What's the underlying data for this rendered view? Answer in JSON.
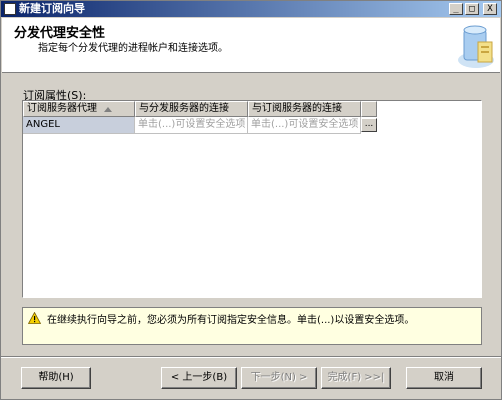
{
  "window": {
    "title": "新建订阅向导",
    "controls": {
      "minimize": "_",
      "maximize": "□",
      "close": "X"
    }
  },
  "header": {
    "heading": "分发代理安全性",
    "subheading": "指定每个分发代理的进程帐户和连接选项。",
    "icon": "wizard-icon"
  },
  "properties": {
    "label": "订阅属性(S):",
    "columns": [
      "订阅服务器代理",
      "与分发服务器的连接",
      "与订阅服务器的连接"
    ],
    "rows": [
      {
        "agent": "ANGEL",
        "distributor_connection": "单击(...)可设置安全选项",
        "subscriber_connection": "单击(...)可设置安全选项",
        "button": "..."
      }
    ]
  },
  "warning": {
    "icon": "warning-icon",
    "text": "在继续执行向导之前，您必须为所有订阅指定安全信息。单击(...)以设置安全选项。"
  },
  "buttons": {
    "help": "帮助(H)",
    "back": "< 上一步(B)",
    "next": "下一步(N) >",
    "finish": "完成(F) >>|",
    "cancel": "取消"
  },
  "colors": {
    "title_bar": "#0a246a",
    "selected_cell": "#c8cfdc",
    "warning_bg": "#ffffe1",
    "dialog_bg": "#d4d0c8"
  }
}
